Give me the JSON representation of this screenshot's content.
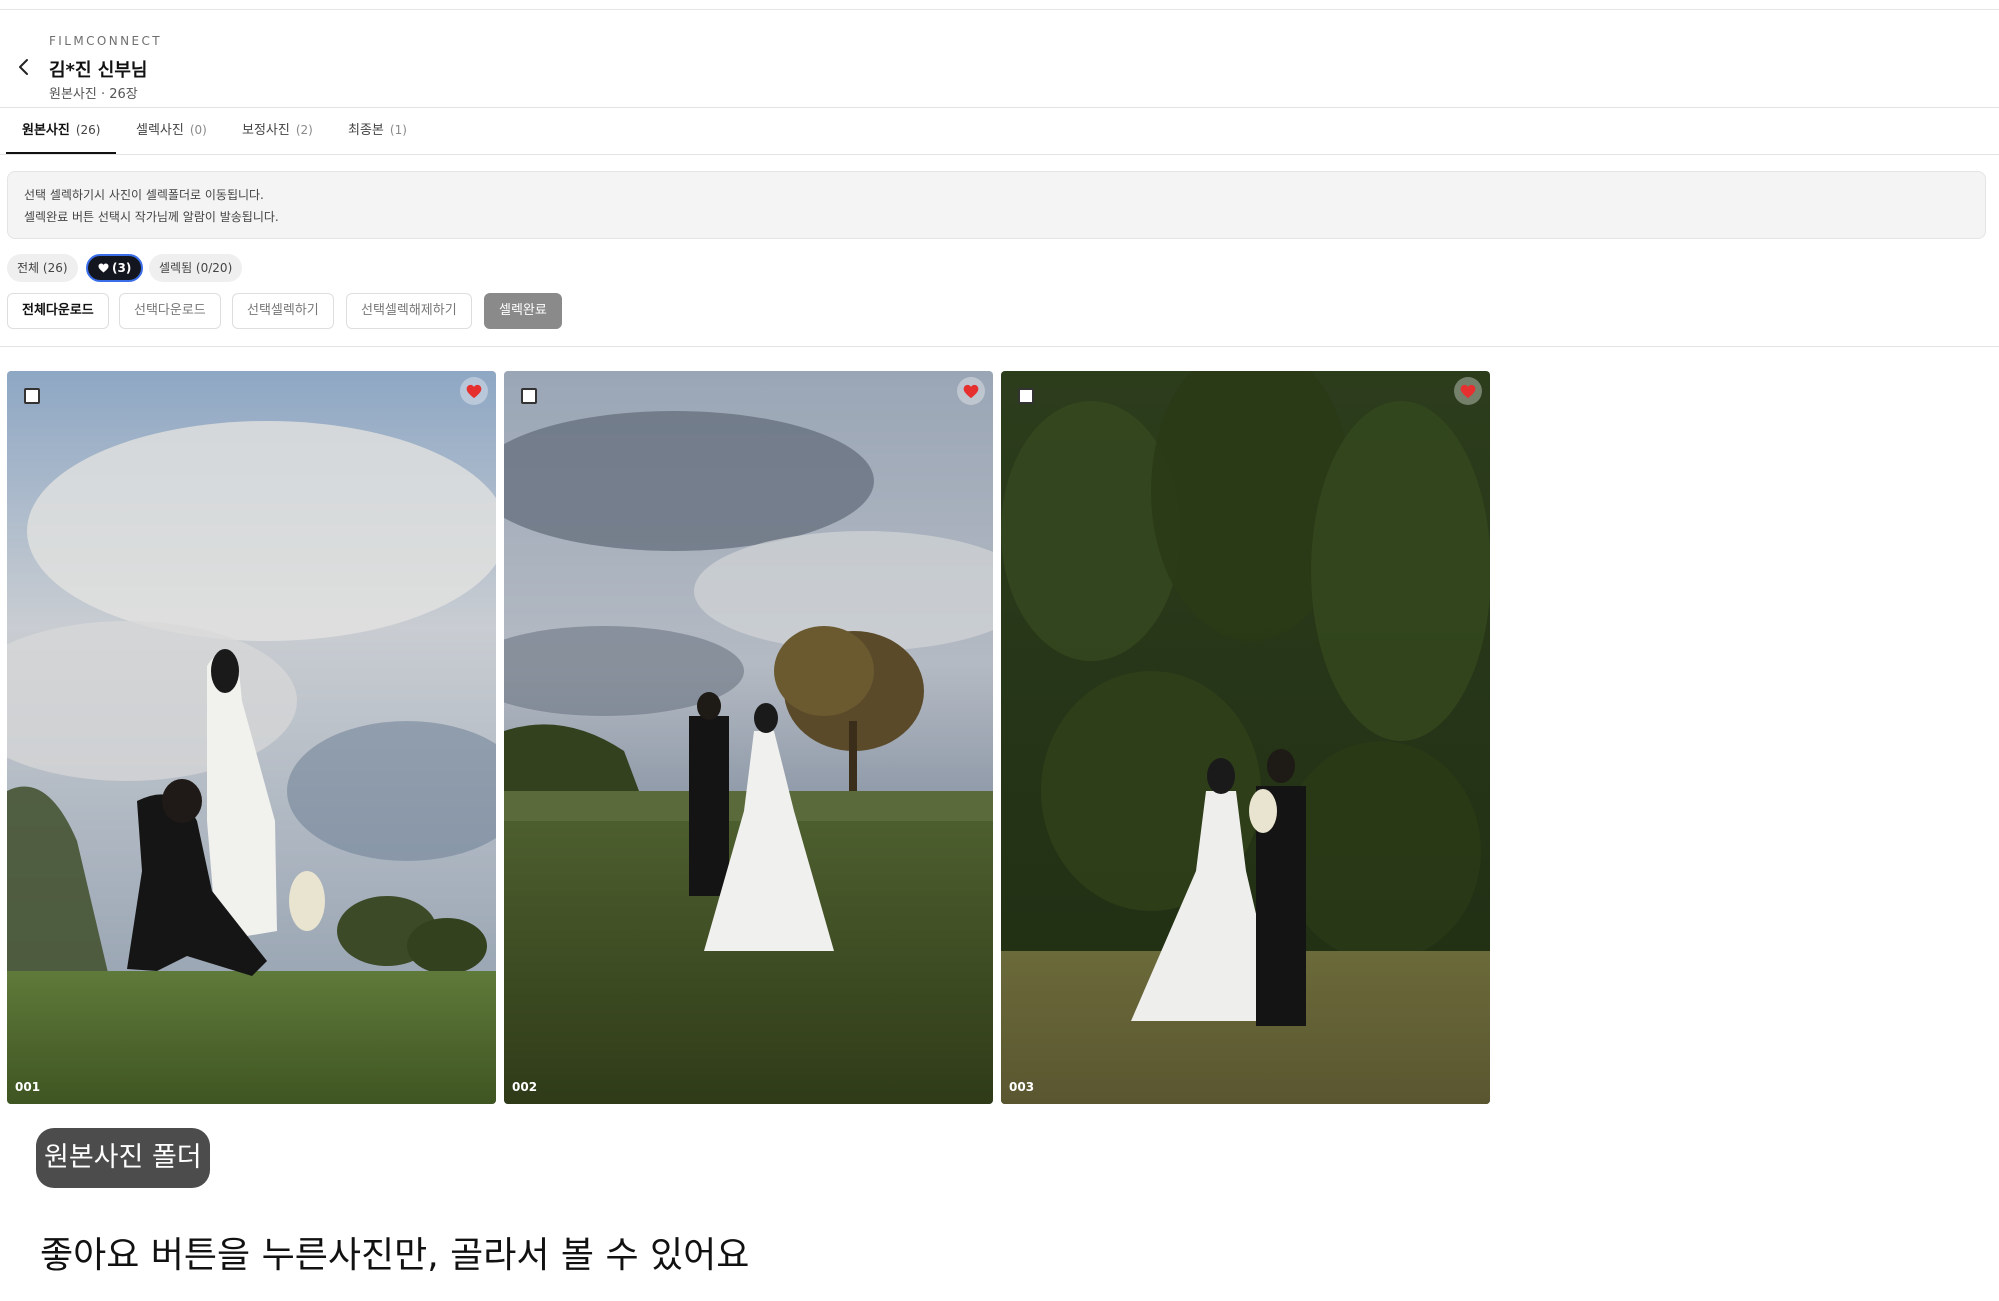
{
  "header": {
    "brand": "FILMCONNECT",
    "title": "김*진 신부님",
    "subtitle": "원본사진 · 26장"
  },
  "tabs": [
    {
      "label": "원본사진",
      "count": "(26)",
      "active": true
    },
    {
      "label": "셀렉사진",
      "count": "(0)",
      "active": false
    },
    {
      "label": "보정사진",
      "count": "(2)",
      "active": false
    },
    {
      "label": "최종본",
      "count": "(1)",
      "active": false
    }
  ],
  "notice": {
    "line1": "선택 셀렉하기시 사진이 셀렉폴더로 이동됩니다.",
    "line2": "셀렉완료 버튼 선택시 작가님께 알람이 발송됩니다."
  },
  "filters": {
    "all": "전체 (26)",
    "liked": "(3)",
    "selected": "셀렉됨 (0/20)"
  },
  "actions": {
    "download_all": "전체다운로드",
    "download_selected": "선택다운로드",
    "select_selected": "선택셀렉하기",
    "unselect_selected": "선택셀렉해제하기",
    "select_done": "셀렉완료"
  },
  "photos": [
    {
      "label": "001",
      "liked": true,
      "checked": false
    },
    {
      "label": "002",
      "liked": true,
      "checked": false
    },
    {
      "label": "003",
      "liked": true,
      "checked": false
    }
  ],
  "overlay": {
    "folder_label": "원본사진 폴더",
    "caption": "좋아요 버튼을 누른사진만, 골라서 볼 수 있어요"
  },
  "colors": {
    "heart": "#e5302f",
    "active_chip_bg": "#14161f",
    "active_chip_border": "#3a6ee8",
    "done_button": "#8a8a8a"
  },
  "icons": {
    "back": "chevron-left-icon",
    "heart": "heart-icon",
    "checkbox": "checkbox-icon"
  }
}
